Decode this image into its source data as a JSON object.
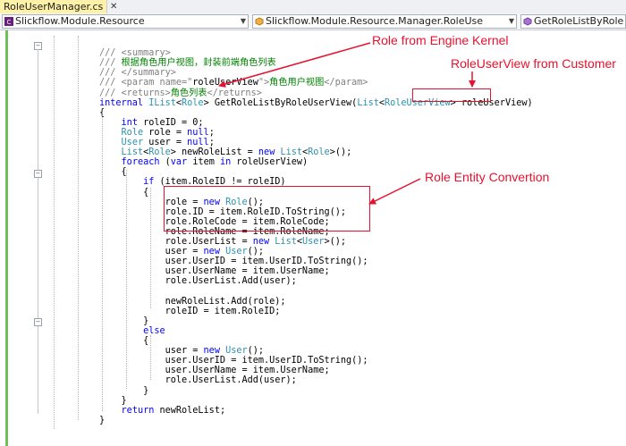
{
  "tabs": {
    "active_label": "RoleUserManager.cs",
    "close_glyph": "✕"
  },
  "nav": {
    "project": "Slickflow.Module.Resource",
    "class_path": "Slickflow.Module.Resource.Manager.RoleUse",
    "member": "GetRoleListByRole"
  },
  "code_lines": [
    {
      "segs": []
    },
    {
      "segs": [
        {
          "t": "/// ",
          "c": "cg"
        },
        {
          "t": "<summary>",
          "c": "cg"
        }
      ]
    },
    {
      "segs": [
        {
          "t": "/// ",
          "c": "cg"
        },
        {
          "t": "根据角色用户视图，封装前端角色列表",
          "c": "cm"
        }
      ]
    },
    {
      "segs": [
        {
          "t": "/// ",
          "c": "cg"
        },
        {
          "t": "</summary>",
          "c": "cg"
        }
      ]
    },
    {
      "segs": [
        {
          "t": "/// ",
          "c": "cg"
        },
        {
          "t": "<param name=\"",
          "c": "cg"
        },
        {
          "t": "roleUserView",
          "c": ""
        },
        {
          "t": "\">",
          "c": "cg"
        },
        {
          "t": "角色用户视图",
          "c": "cm"
        },
        {
          "t": "</param>",
          "c": "cg"
        }
      ]
    },
    {
      "segs": [
        {
          "t": "/// ",
          "c": "cg"
        },
        {
          "t": "<returns>",
          "c": "cg"
        },
        {
          "t": "角色列表",
          "c": "cm"
        },
        {
          "t": "</returns>",
          "c": "cg"
        }
      ]
    },
    {
      "segs": [
        {
          "t": "internal ",
          "c": "kw"
        },
        {
          "t": "IList",
          "c": "ty"
        },
        {
          "t": "<",
          "c": ""
        },
        {
          "t": "Role",
          "c": "ty"
        },
        {
          "t": "> GetRoleListByRoleUserView(",
          "c": ""
        },
        {
          "t": "List",
          "c": "ty"
        },
        {
          "t": "<",
          "c": ""
        },
        {
          "t": "RoleUserView",
          "c": "ty"
        },
        {
          "t": "> roleUserView)",
          "c": ""
        }
      ]
    },
    {
      "segs": [
        {
          "t": "{",
          "c": ""
        }
      ]
    },
    {
      "segs": [
        {
          "t": "    ",
          "c": ""
        },
        {
          "t": "int ",
          "c": "kw"
        },
        {
          "t": "roleID = 0;",
          "c": ""
        }
      ]
    },
    {
      "segs": [
        {
          "t": "    ",
          "c": ""
        },
        {
          "t": "Role ",
          "c": "ty"
        },
        {
          "t": "role = ",
          "c": ""
        },
        {
          "t": "null",
          "c": "kw"
        },
        {
          "t": ";",
          "c": ""
        }
      ]
    },
    {
      "segs": [
        {
          "t": "    ",
          "c": ""
        },
        {
          "t": "User ",
          "c": "ty"
        },
        {
          "t": "user = ",
          "c": ""
        },
        {
          "t": "null",
          "c": "kw"
        },
        {
          "t": ";",
          "c": ""
        }
      ]
    },
    {
      "segs": [
        {
          "t": "    ",
          "c": ""
        },
        {
          "t": "List",
          "c": "ty"
        },
        {
          "t": "<",
          "c": ""
        },
        {
          "t": "Role",
          "c": "ty"
        },
        {
          "t": "> newRoleList = ",
          "c": ""
        },
        {
          "t": "new ",
          "c": "kw"
        },
        {
          "t": "List",
          "c": "ty"
        },
        {
          "t": "<",
          "c": ""
        },
        {
          "t": "Role",
          "c": "ty"
        },
        {
          "t": ">();",
          "c": ""
        }
      ]
    },
    {
      "segs": [
        {
          "t": "    ",
          "c": ""
        },
        {
          "t": "foreach ",
          "c": "kw"
        },
        {
          "t": "(",
          "c": ""
        },
        {
          "t": "var ",
          "c": "kw"
        },
        {
          "t": "item ",
          "c": ""
        },
        {
          "t": "in ",
          "c": "kw"
        },
        {
          "t": "roleUserView)",
          "c": ""
        }
      ]
    },
    {
      "segs": [
        {
          "t": "    {",
          "c": ""
        }
      ]
    },
    {
      "segs": [
        {
          "t": "        ",
          "c": ""
        },
        {
          "t": "if ",
          "c": "kw"
        },
        {
          "t": "(item.RoleID != roleID)",
          "c": ""
        }
      ]
    },
    {
      "segs": [
        {
          "t": "        {",
          "c": ""
        }
      ]
    },
    {
      "segs": [
        {
          "t": "            role = ",
          "c": ""
        },
        {
          "t": "new ",
          "c": "kw"
        },
        {
          "t": "Role",
          "c": "ty"
        },
        {
          "t": "();",
          "c": ""
        }
      ]
    },
    {
      "segs": [
        {
          "t": "            role.ID = item.RoleID.ToString();",
          "c": ""
        }
      ]
    },
    {
      "segs": [
        {
          "t": "            role.RoleCode = item.RoleCode;",
          "c": ""
        }
      ]
    },
    {
      "segs": [
        {
          "t": "            role.RoleName = item.RoleName;",
          "c": ""
        }
      ]
    },
    {
      "segs": [
        {
          "t": "            role.UserList = ",
          "c": ""
        },
        {
          "t": "new ",
          "c": "kw"
        },
        {
          "t": "List",
          "c": "ty"
        },
        {
          "t": "<",
          "c": ""
        },
        {
          "t": "User",
          "c": "ty"
        },
        {
          "t": ">();",
          "c": ""
        }
      ]
    },
    {
      "segs": [
        {
          "t": "            user = ",
          "c": ""
        },
        {
          "t": "new ",
          "c": "kw"
        },
        {
          "t": "User",
          "c": "ty"
        },
        {
          "t": "();",
          "c": ""
        }
      ]
    },
    {
      "segs": [
        {
          "t": "            user.UserID = item.UserID.ToString();",
          "c": ""
        }
      ]
    },
    {
      "segs": [
        {
          "t": "            user.UserName = item.UserName;",
          "c": ""
        }
      ]
    },
    {
      "segs": [
        {
          "t": "            role.UserList.Add(user);",
          "c": ""
        }
      ]
    },
    {
      "segs": []
    },
    {
      "segs": [
        {
          "t": "            newRoleList.Add(role);",
          "c": ""
        }
      ]
    },
    {
      "segs": [
        {
          "t": "            roleID = item.RoleID;",
          "c": ""
        }
      ]
    },
    {
      "segs": [
        {
          "t": "        }",
          "c": ""
        }
      ]
    },
    {
      "segs": [
        {
          "t": "        ",
          "c": ""
        },
        {
          "t": "else",
          "c": "kw"
        }
      ]
    },
    {
      "segs": [
        {
          "t": "        {",
          "c": ""
        }
      ]
    },
    {
      "segs": [
        {
          "t": "            user = ",
          "c": ""
        },
        {
          "t": "new ",
          "c": "kw"
        },
        {
          "t": "User",
          "c": "ty"
        },
        {
          "t": "();",
          "c": ""
        }
      ]
    },
    {
      "segs": [
        {
          "t": "            user.UserID = item.UserID.ToString();",
          "c": ""
        }
      ]
    },
    {
      "segs": [
        {
          "t": "            user.UserName = item.UserName;",
          "c": ""
        }
      ]
    },
    {
      "segs": [
        {
          "t": "            role.UserList.Add(user);",
          "c": ""
        }
      ]
    },
    {
      "segs": [
        {
          "t": "        }",
          "c": ""
        }
      ]
    },
    {
      "segs": [
        {
          "t": "    }",
          "c": ""
        }
      ]
    },
    {
      "segs": [
        {
          "t": "    ",
          "c": ""
        },
        {
          "t": "return ",
          "c": "kw"
        },
        {
          "t": "newRoleList;",
          "c": ""
        }
      ]
    },
    {
      "segs": [
        {
          "t": "}",
          "c": ""
        }
      ]
    }
  ],
  "annotations": {
    "role_engine": "Role from Engine Kernel",
    "role_user_view": "RoleUserView from Customer",
    "role_entity": "Role Entity Convertion"
  },
  "colors": {
    "annotation": "#e8112d",
    "keyword": "#0000ff",
    "type": "#2b91af",
    "comment": "#008000",
    "doc_tag": "#808080",
    "active_tab": "#fff1a8"
  }
}
